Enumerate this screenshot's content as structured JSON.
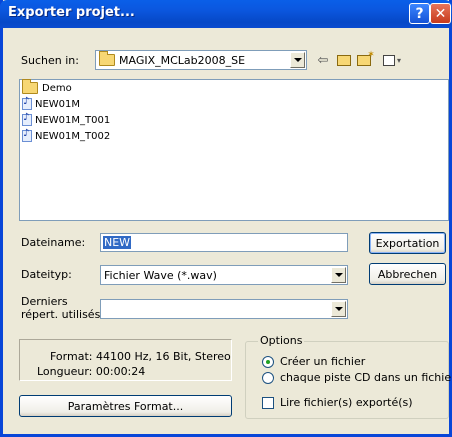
{
  "window": {
    "title": "Exporter projet..."
  },
  "look_in": {
    "label": "Suchen in:",
    "value": "MAGIX_MCLab2008_SE"
  },
  "files": [
    {
      "name": "Demo",
      "type": "folder"
    },
    {
      "name": "NEW01M",
      "type": "audio"
    },
    {
      "name": "NEW01M_T001",
      "type": "audio"
    },
    {
      "name": "NEW01M_T002",
      "type": "audio"
    }
  ],
  "filename": {
    "label": "Dateiname:",
    "value": "NEW"
  },
  "filetype": {
    "label": "Dateityp:",
    "value": "Fichier Wave (*.wav)"
  },
  "recent": {
    "label_line1": "Derniers",
    "label_line2": "répert. utilisés:",
    "value": ""
  },
  "buttons": {
    "export": "Exportation",
    "cancel": "Abbrechen",
    "format_params": "Paramètres Format..."
  },
  "info": {
    "format": "Format: 44100 Hz, 16 Bit, Stereo",
    "length": "Longueur: 00:00:24"
  },
  "options": {
    "title": "Options",
    "radio_single": "Créer un fichier",
    "radio_per_track": "chaque piste CD dans un fichier",
    "selected": "radio_single",
    "checkbox_read": "Lire fichier(s) exporté(s)",
    "checkbox_checked": false
  },
  "colors": {
    "titlebar": "#0846d8",
    "dialog_bg": "#ece9d8",
    "desktop": "#f2c4e6",
    "selection": "#316ac5"
  }
}
